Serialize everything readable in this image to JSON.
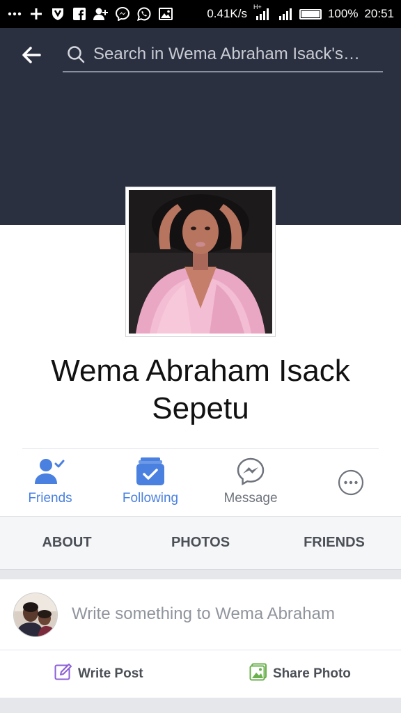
{
  "status_bar": {
    "network_speed": "0.41K/s",
    "battery": "100%",
    "battery_level": 1.0,
    "time": "20:51",
    "left_icons": [
      "more-dots-icon",
      "plus-icon",
      "shield-icon",
      "facebook-icon",
      "add-person-icon",
      "messenger-icon",
      "whatsapp-icon",
      "image-icon"
    ],
    "network_type": "H+"
  },
  "header": {
    "search_placeholder": "Search in Wema Abraham Isack's…"
  },
  "profile": {
    "name": "Wema Abraham Isack Sepetu"
  },
  "actions": {
    "friends": "Friends",
    "following": "Following",
    "message": "Message"
  },
  "tabs": {
    "about": "ABOUT",
    "photos": "PHOTOS",
    "friends": "FRIENDS"
  },
  "composer": {
    "prompt": "Write something to Wema Abraham",
    "write_post": "Write Post",
    "share_photo": "Share Photo"
  },
  "colors": {
    "cover": "#2b3040",
    "accent_blue": "#4a80e0",
    "write_post_icon": "#8b5fd6",
    "share_photo_icon": "#6ab04c"
  }
}
